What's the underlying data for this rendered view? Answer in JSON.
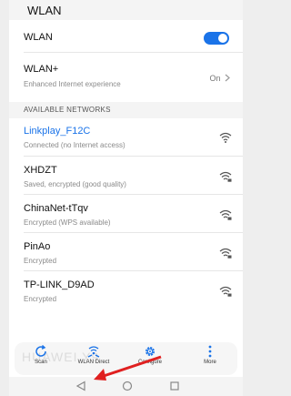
{
  "header": {
    "title": "WLAN"
  },
  "wlan": {
    "label": "WLAN",
    "enabled": true
  },
  "wlan_plus": {
    "label": "WLAN+",
    "subtitle": "Enhanced Internet experience",
    "value": "On"
  },
  "section": {
    "label": "AVAILABLE NETWORKS"
  },
  "networks": [
    {
      "name": "Linkplay_F12C",
      "status": "Connected (no Internet access)",
      "connected": true,
      "icon": "wifi-icon"
    },
    {
      "name": "XHDZT",
      "status": "Saved, encrypted (good quality)",
      "connected": false,
      "icon": "wifi-lock-icon"
    },
    {
      "name": "ChinaNet-tTqv",
      "status": "Encrypted (WPS available)",
      "connected": false,
      "icon": "wifi-lock-icon"
    },
    {
      "name": "PinAo",
      "status": "Encrypted",
      "connected": false,
      "icon": "wifi-lock-icon"
    },
    {
      "name": "TP-LINK_D9AD",
      "status": "Encrypted",
      "connected": false,
      "icon": "wifi-lock-icon"
    }
  ],
  "bottom_actions": [
    {
      "label": "Scan",
      "icon": "refresh-icon"
    },
    {
      "label": "WLAN Direct",
      "icon": "wifi-direct-icon"
    },
    {
      "label": "Configure",
      "icon": "gear-icon"
    },
    {
      "label": "More",
      "icon": "more-vertical-icon"
    }
  ],
  "watermark": "HUAWEI Y9",
  "nav": {
    "back_icon": "back-triangle-icon",
    "home_icon": "home-circle-icon",
    "recents_icon": "recents-square-icon"
  },
  "colors": {
    "accent": "#1a73e8",
    "connected_text": "#1a73e8",
    "annotation_arrow": "#e02020"
  }
}
